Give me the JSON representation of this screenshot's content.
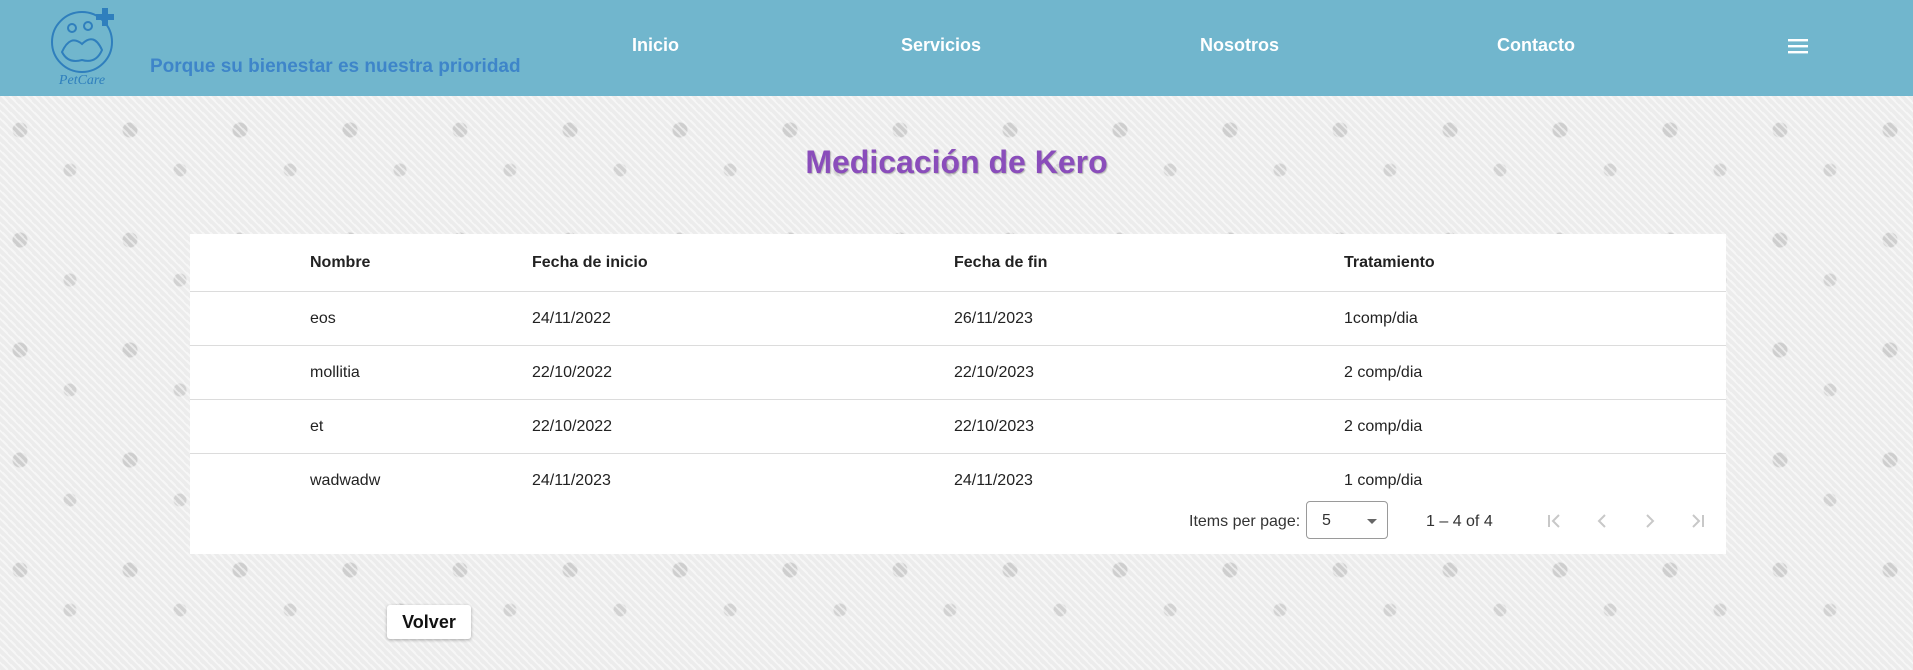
{
  "header": {
    "brand": "PetCare",
    "tagline": "Porque su bienestar es nuestra prioridad",
    "nav": [
      "Inicio",
      "Servicios",
      "Nosotros",
      "Contacto"
    ],
    "brand_color": "#71b6cd",
    "icons": {
      "logo": "petcare-logo-icon",
      "menu": "hamburger-menu-icon"
    }
  },
  "page": {
    "title": "Medicación de Kero",
    "title_color": "#8a4dbb"
  },
  "table": {
    "columns": [
      "Nombre",
      "Fecha de inicio",
      "Fecha de fin",
      "Tratamiento"
    ],
    "rows": [
      [
        "eos",
        "24/11/2022",
        "26/11/2023",
        "1comp/dia"
      ],
      [
        "mollitia",
        "22/10/2022",
        "22/10/2023",
        "2 comp/dia"
      ],
      [
        "et",
        "22/10/2022",
        "22/10/2023",
        "2 comp/dia"
      ],
      [
        "wadwadw",
        "24/11/2023",
        "24/11/2023",
        "1 comp/dia"
      ]
    ]
  },
  "paginator": {
    "items_per_page_label": "Items per page:",
    "items_per_page_value": "5",
    "range_label": "1 – 4 of 4",
    "icons": [
      "first-page-icon",
      "previous-page-icon",
      "next-page-icon",
      "last-page-icon"
    ]
  },
  "actions": {
    "back_label": "Volver"
  }
}
